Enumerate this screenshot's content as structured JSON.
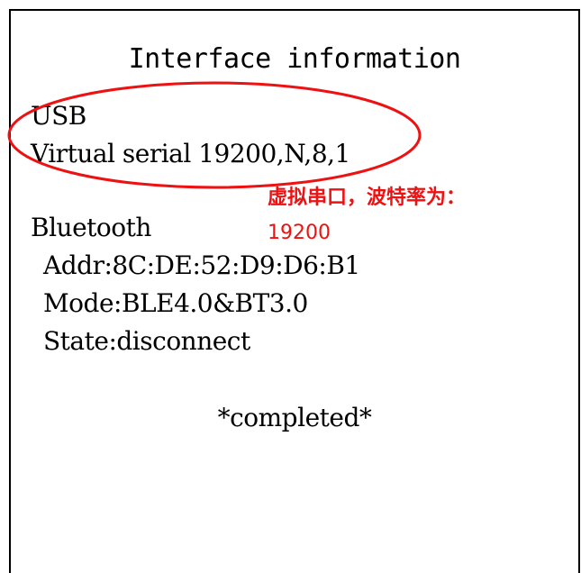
{
  "receipt": {
    "title": "Interface information",
    "usb_label": "USB",
    "virtual_serial": "Virtual serial 19200,N,8,1",
    "bluetooth_label": "Bluetooth",
    "addr": "Addr:8C:DE:52:D9:D6:B1",
    "mode": "Mode:BLE4.0&BT3.0",
    "state": "State:disconnect",
    "completed": "*completed*"
  },
  "annotation": {
    "text": "虚拟串口，波特率为：",
    "baud": "19200",
    "color": "#ee1111"
  }
}
